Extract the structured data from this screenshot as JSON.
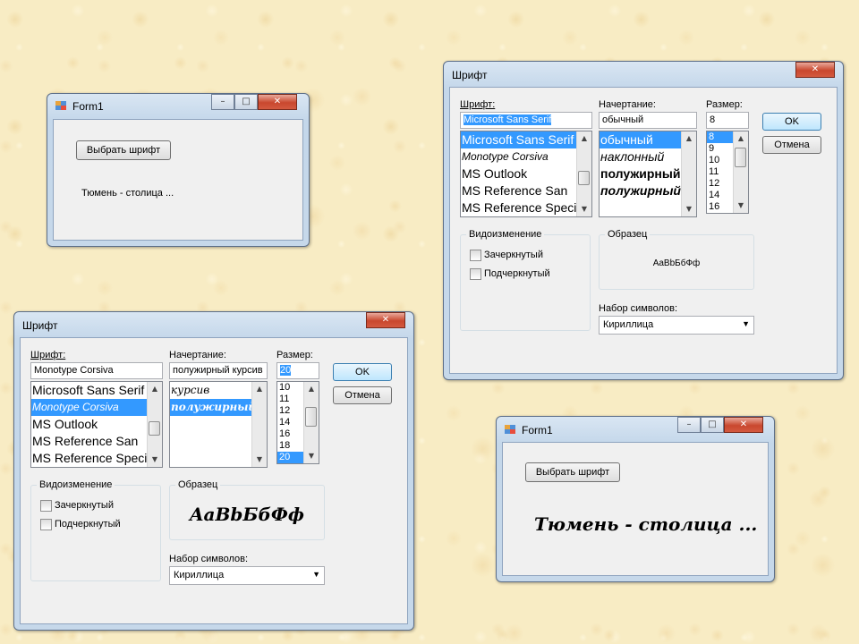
{
  "form1_a": {
    "title": "Form1",
    "button": "Выбрать шрифт",
    "label": "Тюмень - столица ..."
  },
  "form1_b": {
    "title": "Form1",
    "button": "Выбрать шрифт",
    "label": "Тюмень - столица ..."
  },
  "font_dialog_a": {
    "title": "Шрифт",
    "font_label": "Шрифт:",
    "style_label": "Начертание:",
    "size_label": "Размер:",
    "font_value": "Microsoft Sans Serif",
    "style_value": "обычный",
    "size_value": "8",
    "fonts": [
      "Microsoft Sans Serif",
      "Monotype Corsiva",
      "MS Outlook",
      "MS Reference San",
      "MS Reference Speci"
    ],
    "styles": [
      "обычный",
      "наклонный",
      "полужирный",
      "полужирный"
    ],
    "sizes": [
      "8",
      "9",
      "10",
      "11",
      "12",
      "14",
      "16"
    ],
    "ok": "OK",
    "cancel": "Отмена",
    "effects_label": "Видоизменение",
    "strikeout": "Зачеркнутый",
    "underline": "Подчеркнутый",
    "sample_label": "Образец",
    "sample_text": "AaBbБбФф",
    "charset_label": "Набор символов:",
    "charset_value": "Кириллица"
  },
  "font_dialog_b": {
    "title": "Шрифт",
    "font_label": "Шрифт:",
    "style_label": "Начертание:",
    "size_label": "Размер:",
    "font_value": "Monotype Corsiva",
    "style_value": "полужирный курсив",
    "size_value": "20",
    "fonts": [
      "Microsoft Sans Serif",
      "Monotype Corsiva",
      "MS Outlook",
      "MS Reference San",
      "MS Reference Speci"
    ],
    "styles": [
      "курсив",
      "полужирный ку"
    ],
    "sizes": [
      "10",
      "11",
      "12",
      "14",
      "16",
      "18",
      "20"
    ],
    "ok": "OK",
    "cancel": "Отмена",
    "effects_label": "Видоизменение",
    "strikeout": "Зачеркнутый",
    "underline": "Подчеркнутый",
    "sample_label": "Образец",
    "sample_text": "AaBbБбФф",
    "charset_label": "Набор символов:",
    "charset_value": "Кириллица"
  }
}
